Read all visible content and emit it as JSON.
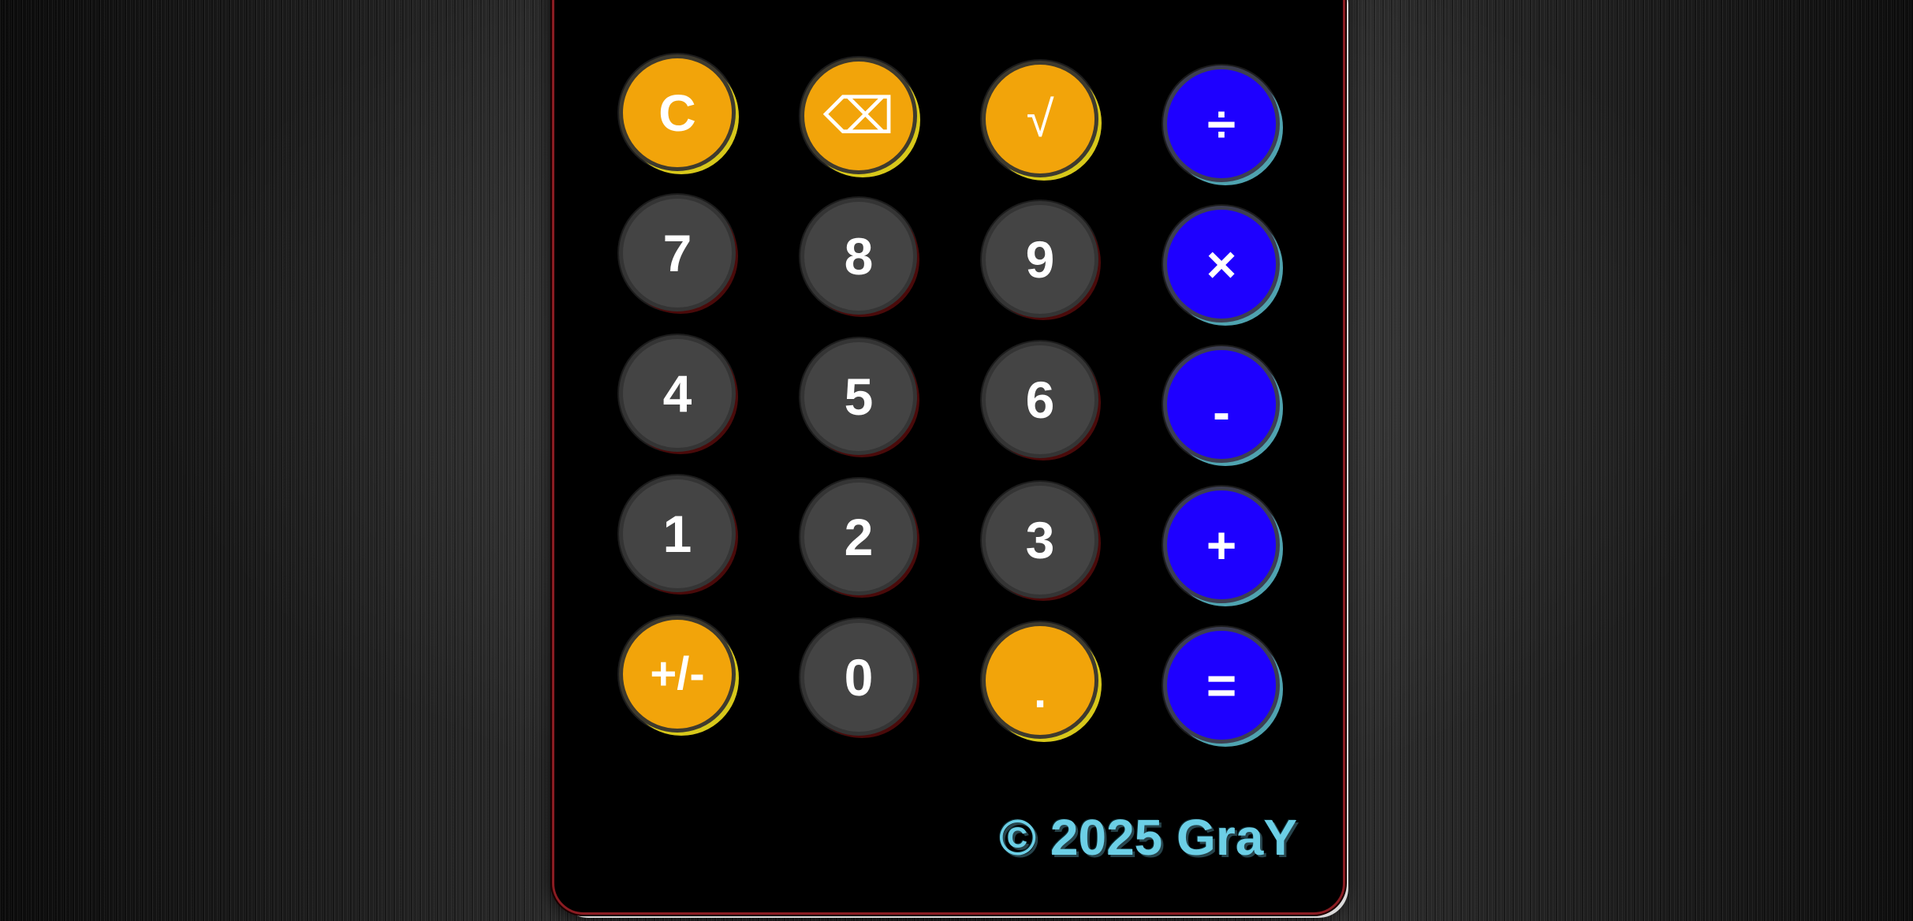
{
  "keypad": {
    "rows": [
      [
        "C",
        "⌫",
        "√",
        "÷"
      ],
      [
        "7",
        "8",
        "9",
        "×"
      ],
      [
        "4",
        "5",
        "6",
        "-"
      ],
      [
        "1",
        "2",
        "3",
        "+"
      ],
      [
        "+/-",
        "0",
        ".",
        "="
      ]
    ]
  },
  "footer": {
    "copyright": "© 2025 GraY"
  },
  "colors": {
    "number_key": "#444444",
    "function_key": "#f2a40a",
    "operator_key": "#1e00ff",
    "calculator_body": "#000000",
    "body_border": "#8a1c22",
    "footer_text": "#6ccfe6"
  }
}
